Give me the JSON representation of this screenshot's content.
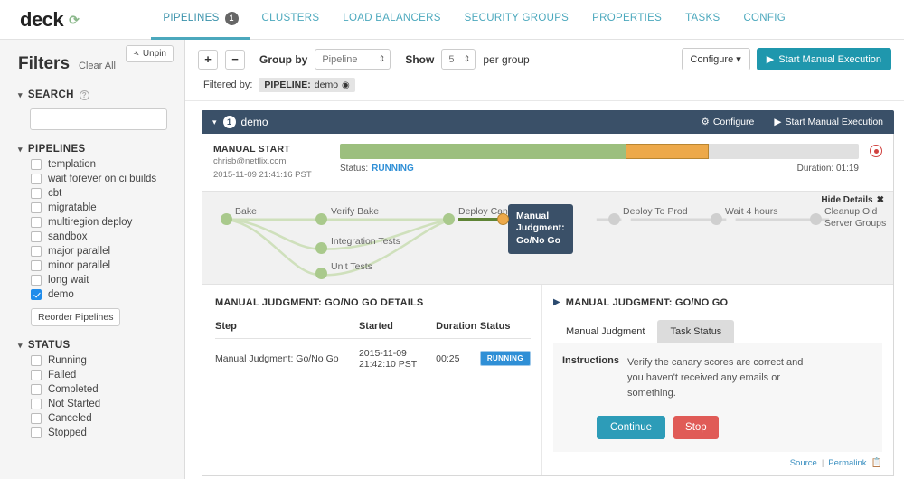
{
  "app": {
    "brand": "deck",
    "refresh_icon": "refresh-icon"
  },
  "nav": {
    "tabs": [
      {
        "label": "PIPELINES",
        "badge": "1",
        "active": true
      },
      {
        "label": "CLUSTERS",
        "active": false
      },
      {
        "label": "LOAD BALANCERS",
        "active": false
      },
      {
        "label": "SECURITY GROUPS",
        "active": false
      },
      {
        "label": "PROPERTIES",
        "active": false
      },
      {
        "label": "TASKS",
        "active": false
      },
      {
        "label": "CONFIG",
        "active": false
      }
    ]
  },
  "sidebar": {
    "title": "Filters",
    "clear_all": "Clear All",
    "unpin": "Unpin",
    "search_group": {
      "label": "SEARCH",
      "value": "",
      "placeholder": ""
    },
    "pipelines_group": {
      "label": "PIPELINES",
      "items": [
        {
          "label": "templation",
          "checked": false
        },
        {
          "label": "wait forever on ci builds",
          "checked": false
        },
        {
          "label": "cbt",
          "checked": false
        },
        {
          "label": "migratable",
          "checked": false
        },
        {
          "label": "multiregion deploy",
          "checked": false
        },
        {
          "label": "sandbox",
          "checked": false
        },
        {
          "label": "major parallel",
          "checked": false
        },
        {
          "label": "minor parallel",
          "checked": false
        },
        {
          "label": "long wait",
          "checked": false
        },
        {
          "label": "demo",
          "checked": true
        }
      ],
      "reorder_button": "Reorder Pipelines"
    },
    "status_group": {
      "label": "STATUS",
      "items": [
        {
          "label": "Running",
          "checked": false
        },
        {
          "label": "Failed",
          "checked": false
        },
        {
          "label": "Completed",
          "checked": false
        },
        {
          "label": "Not Started",
          "checked": false
        },
        {
          "label": "Canceled",
          "checked": false
        },
        {
          "label": "Stopped",
          "checked": false
        }
      ]
    }
  },
  "toolbar": {
    "add_label": "+",
    "remove_label": "−",
    "group_by_label": "Group by",
    "group_by_value": "Pipeline",
    "show_label": "Show",
    "show_value": "5",
    "per_group_label": "per group",
    "configure_label": "Configure",
    "start_manual_execution_label": "Start Manual Execution"
  },
  "filtered_by": {
    "label": "Filtered by:",
    "pill_key": "PIPELINE:",
    "pill_value": "demo"
  },
  "execution": {
    "header": {
      "count": "1",
      "name": "demo",
      "configure": "Configure",
      "start_manual_execution": "Start Manual Execution"
    },
    "meta": {
      "title": "MANUAL START",
      "user": "chrisb@netflix.com",
      "timestamp": "2015-11-09 21:41:16 PST"
    },
    "progress": {
      "status_label": "Status:",
      "status_value": "RUNNING",
      "duration_label": "Duration: 01:19",
      "green_pct": 55,
      "orange_pct": 16,
      "grey_pct": 29,
      "green_color": "#9cbf7e",
      "orange_color": "#eda94a",
      "grey_color": "#e0e0e0"
    },
    "graph": {
      "hide_details": "Hide Details",
      "stages": [
        {
          "label": "Bake",
          "state": "green"
        },
        {
          "label": "Verify Bake",
          "state": "green"
        },
        {
          "label": "Integration Tests",
          "state": "green"
        },
        {
          "label": "Unit Tests",
          "state": "green"
        },
        {
          "label": "Deploy Canary",
          "state": "green"
        },
        {
          "label": "Manual Judgment: Go/No Go",
          "state": "orange"
        },
        {
          "label": "Deploy To Prod",
          "state": "grey"
        },
        {
          "label": "Wait 4 hours",
          "state": "grey"
        },
        {
          "label": "Cleanup Old Server Groups",
          "state": "grey"
        }
      ],
      "active_node_label": "Manual\nJudgment:\nGo/No Go",
      "active_node_line1": "Manual",
      "active_node_line2": "Judgment:",
      "active_node_line3": "Go/No Go"
    },
    "details_left": {
      "title": "MANUAL JUDGMENT: GO/NO GO DETAILS",
      "columns": [
        "Step",
        "Started",
        "Duration",
        "Status"
      ],
      "rows": [
        {
          "step": "Manual Judgment: Go/No Go",
          "started": "2015-11-09 21:42:10 PST",
          "duration": "00:25",
          "status": "RUNNING"
        }
      ]
    },
    "details_right": {
      "title": "MANUAL JUDGMENT: GO/NO GO",
      "tabs": [
        {
          "label": "Manual Judgment",
          "active": true
        },
        {
          "label": "Task Status",
          "active": false
        }
      ],
      "instructions_label": "Instructions",
      "instructions_text": "Verify the canary scores are correct and you haven't received any emails or something.",
      "continue_label": "Continue",
      "stop_label": "Stop",
      "footer_source": "Source",
      "footer_permalink": "Permalink"
    }
  }
}
